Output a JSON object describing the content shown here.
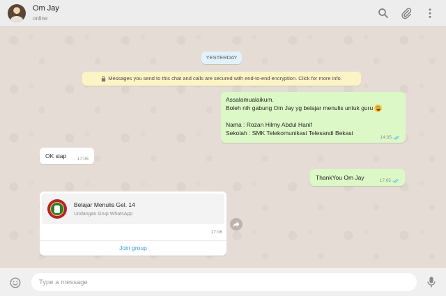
{
  "header": {
    "contact_name": "Om Jay",
    "status": "online",
    "icons": [
      "search-icon",
      "attach-icon",
      "menu-icon"
    ]
  },
  "chat": {
    "date_chip": "YESTERDAY",
    "encryption_notice": "Messages you send to this chat and calls are secured with end-to-end encryption. Click for more info.",
    "messages": [
      {
        "direction": "outgoing",
        "lines": [
          "Assalamualaikum.",
          "Boleh nih gabung Om Jay yg belajar menulis untuk guru",
          "",
          "Nama : Rozan Hilmy Abdul Hanif",
          "Sekolah : SMK Telekomunikasi Telesandi Bekasi"
        ],
        "time": "14:35",
        "read": true
      },
      {
        "direction": "incoming",
        "text": "OK siap",
        "time": "17:05"
      },
      {
        "direction": "outgoing",
        "text": "ThankYou Om Jay",
        "time": "17:05",
        "read": true
      },
      {
        "direction": "incoming",
        "type": "group-invite",
        "group_name": "Belajar Menulis Gel. 14",
        "subtitle": "Undangan Grup WhatsApp",
        "time": "17:06",
        "action_label": "Join group"
      }
    ]
  },
  "footer": {
    "input_placeholder": "Type a message",
    "input_value": ""
  },
  "colors": {
    "outgoing_bubble": "#dcf8c6",
    "incoming_bubble": "#ffffff",
    "read_ticks": "#4fc3f7",
    "link": "#3a9bd9",
    "chat_background": "#e5ddd5"
  }
}
